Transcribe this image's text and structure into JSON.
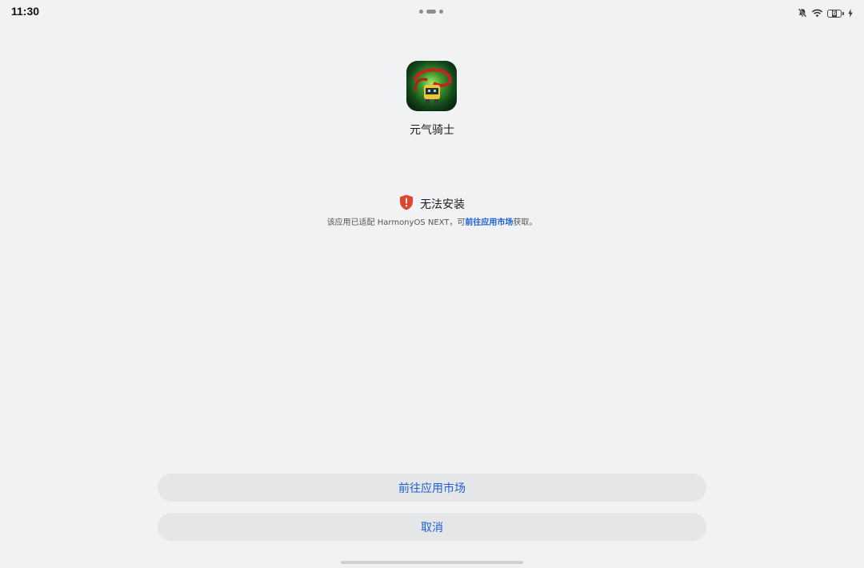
{
  "status_bar": {
    "time": "11:30",
    "battery_level": "6",
    "icons": [
      "bell-off-icon",
      "wifi-icon",
      "battery-icon",
      "charging-icon"
    ]
  },
  "app": {
    "name": "元气骑士",
    "icon": "soul-knight-app-icon"
  },
  "warning": {
    "icon": "shield-alert-icon",
    "title": "无法安装",
    "desc_prefix": "该应用已适配 HarmonyOS NEXT，可",
    "desc_link": "前往应用市场",
    "desc_suffix": "获取。",
    "colors": {
      "shield": "#e0452f",
      "link": "#1a5fd6"
    }
  },
  "buttons": {
    "market_label": "前往应用市场",
    "cancel_label": "取消"
  }
}
